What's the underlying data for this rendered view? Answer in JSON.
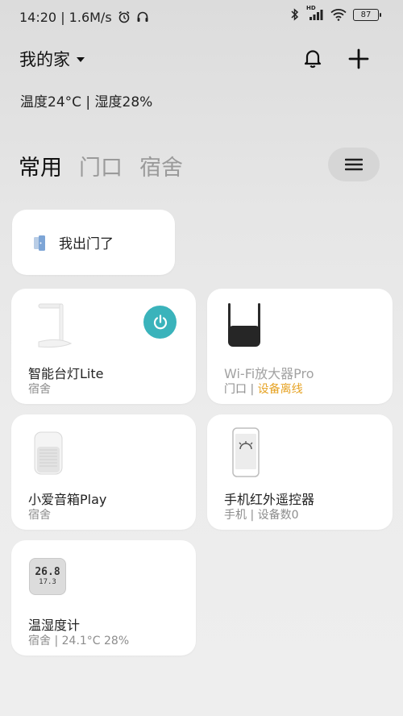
{
  "status": {
    "time": "14:20",
    "speed": "1.6M/s",
    "hd": "HD",
    "battery": "87"
  },
  "header": {
    "home_name": "我的家"
  },
  "climate": "温度24°C | 湿度28%",
  "tabs": [
    {
      "label": "常用"
    },
    {
      "label": "门口"
    },
    {
      "label": "宿舍"
    }
  ],
  "scene": {
    "label": "我出门了"
  },
  "devices": [
    {
      "name": "智能台灯Lite",
      "room": "宿舍"
    },
    {
      "name": "Wi-Fi放大器Pro",
      "room": "门口",
      "state": "设备离线",
      "accent": "#e6a325"
    },
    {
      "name": "小爱音箱Play",
      "room": "宿舍"
    },
    {
      "name": "手机红外遥控器",
      "room": "手机",
      "extra": "设备数0"
    },
    {
      "name": "温湿度计",
      "room": "宿舍",
      "extra": "24.1°C 28%",
      "display_top": "26.8",
      "display_bottom": "17.3"
    }
  ],
  "colors": {
    "power_on": "#3ab3bb",
    "offline_text": "#e6a325"
  }
}
